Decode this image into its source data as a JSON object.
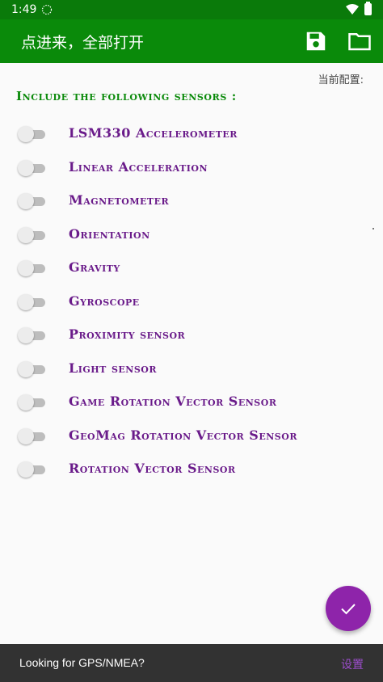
{
  "status_bar": {
    "time": "1:49"
  },
  "app_bar": {
    "title": "点进来，全部打开",
    "save_icon": "save-icon",
    "folder_icon": "folder-icon"
  },
  "config_label": "当前配置:",
  "section_title": "Include the following sensors :",
  "sensors": [
    {
      "label": "LSM330 Accelerometer",
      "enabled": false
    },
    {
      "label": "Linear Acceleration",
      "enabled": false
    },
    {
      "label": "Magnetometer",
      "enabled": false
    },
    {
      "label": "Orientation",
      "enabled": false
    },
    {
      "label": "Gravity",
      "enabled": false
    },
    {
      "label": "Gyroscope",
      "enabled": false
    },
    {
      "label": "Proximity sensor",
      "enabled": false
    },
    {
      "label": "Light sensor",
      "enabled": false
    },
    {
      "label": "Game Rotation Vector Sensor",
      "enabled": false
    },
    {
      "label": "GeoMag Rotation Vector Sensor",
      "enabled": false
    },
    {
      "label": "Rotation Vector Sensor",
      "enabled": false
    }
  ],
  "fab_icon": "check-icon",
  "snackbar": {
    "message": "Looking for GPS/NMEA?",
    "action": "设置"
  },
  "colors": {
    "primary": "#0a8a0a",
    "accent": "#8e24aa",
    "label": "#6a1b8a"
  }
}
